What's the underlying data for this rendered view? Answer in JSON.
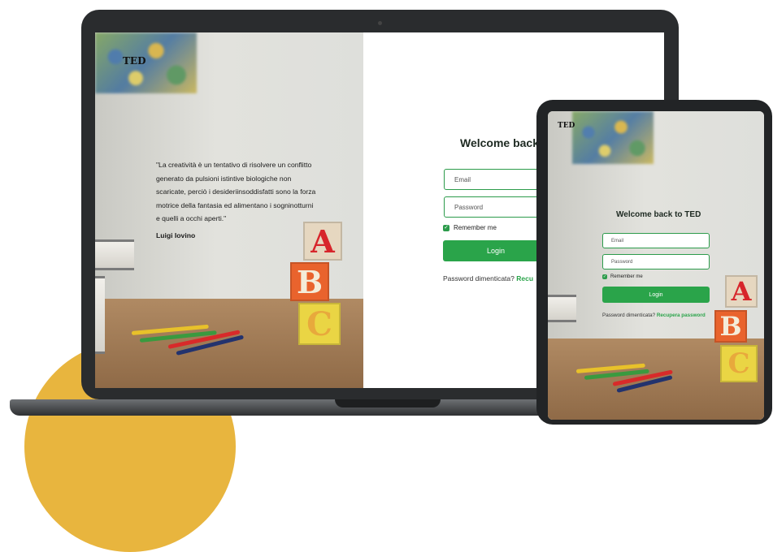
{
  "brand": "TED",
  "quote": {
    "text": "\"La creatività è un tentativo di risolvere un conflitto generato da pulsioni istintive biologiche non scaricate, perciò i desideriinsoddisfatti sono la forza motrice della fantasia ed alimentano i sogninotturni e quelli a occhi aperti.\"",
    "author": "Luigi Iovino"
  },
  "laptop_form": {
    "title": "Welcome back",
    "email_placeholder": "Email",
    "password_placeholder": "Password",
    "remember_label": "Remember me",
    "login_label": "Login",
    "forgot_label": "Password dimenticata?",
    "recover_label": "Recu"
  },
  "tablet_form": {
    "title": "Welcome back to TED",
    "email_placeholder": "Email",
    "password_placeholder": "Password",
    "remember_label": "Remember me",
    "login_label": "Login",
    "forgot_label": "Password dimenticata?",
    "recover_label": "Recupera password"
  },
  "blocks": {
    "a": "A",
    "b": "B",
    "c": "C"
  },
  "colors": {
    "accent": "#2aa44a",
    "device_frame": "#2a2c2e",
    "blob": "#e8b53e"
  }
}
